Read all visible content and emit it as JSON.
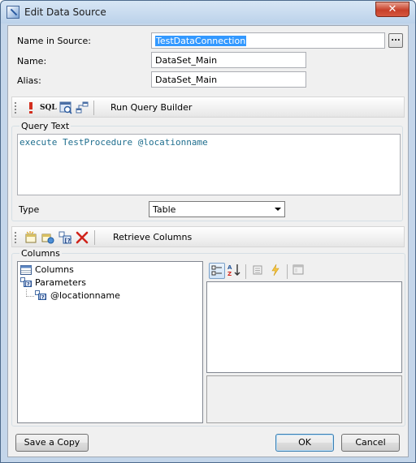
{
  "window": {
    "title": "Edit Data Source",
    "close_glyph": "✕"
  },
  "form": {
    "name_in_source_label": "Name in Source:",
    "name_in_source_value": "TestDataConnection",
    "browse_label": "...",
    "name_label": "Name:",
    "name_value": "DataSet_Main",
    "alias_label": "Alias:",
    "alias_value": "DataSet_Main"
  },
  "query_toolbar": {
    "icons": [
      "run-icon",
      "sql-icon",
      "view-query-icon",
      "query-builder-icon"
    ],
    "sql_text": "SQL",
    "run_query_builder_label": "Run Query Builder"
  },
  "query": {
    "group_label": "Query Text",
    "text": "execute TestProcedure @locationname",
    "type_label": "Type",
    "type_value": "Table"
  },
  "columns_toolbar": {
    "icons": [
      "new-column-icon",
      "new-calculated-column-icon",
      "new-parameter-icon",
      "delete-icon"
    ],
    "retrieve_label": "Retrieve Columns"
  },
  "columns": {
    "group_label": "Columns",
    "tree": [
      {
        "label": "Columns",
        "icon": "columns-icon",
        "level": 0,
        "selected": true
      },
      {
        "label": "Parameters",
        "icon": "parameters-icon",
        "level": 0
      },
      {
        "label": "@locationname",
        "icon": "parameter-icon",
        "level": 1
      }
    ],
    "property_tools": [
      "categorized-icon",
      "alphabetical-icon",
      "properties-icon",
      "events-icon",
      "property-pages-icon"
    ]
  },
  "buttons": {
    "save_copy": "Save a Copy",
    "ok": "OK",
    "cancel": "Cancel"
  },
  "colors": {
    "accent": "#3399ff",
    "query_text": "#1f6e8e",
    "delete_red": "#d0231a"
  }
}
